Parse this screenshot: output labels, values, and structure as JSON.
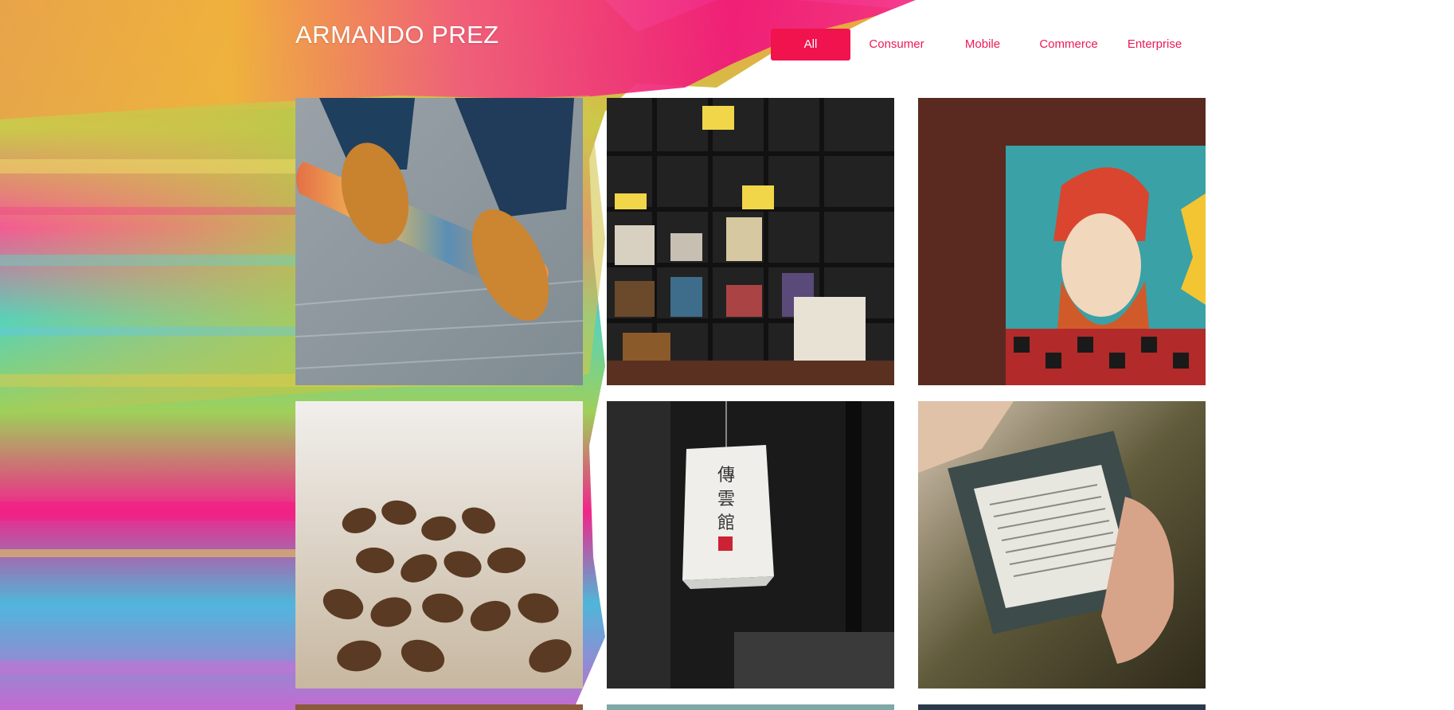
{
  "brand": {
    "title": "ARMANDO PREZ"
  },
  "filters": [
    {
      "label": "All",
      "active": true
    },
    {
      "label": "Consumer",
      "active": false
    },
    {
      "label": "Mobile",
      "active": false
    },
    {
      "label": "Commerce",
      "active": false
    },
    {
      "label": "Enterprise",
      "active": false
    }
  ],
  "colors": {
    "accent": "#f0134d",
    "filter_text": "#ec1a54",
    "background": "#ffffff"
  },
  "portfolio": {
    "items": [
      {
        "subject": "shoes-on-skateboard"
      },
      {
        "subject": "bookshelf"
      },
      {
        "subject": "bearded-man-mural"
      },
      {
        "subject": "coffee-beans"
      },
      {
        "subject": "paper-lantern"
      },
      {
        "subject": "ereader-in-hand"
      },
      {
        "subject": "partial-image-1"
      },
      {
        "subject": "partial-image-2"
      },
      {
        "subject": "partial-image-3"
      }
    ]
  }
}
